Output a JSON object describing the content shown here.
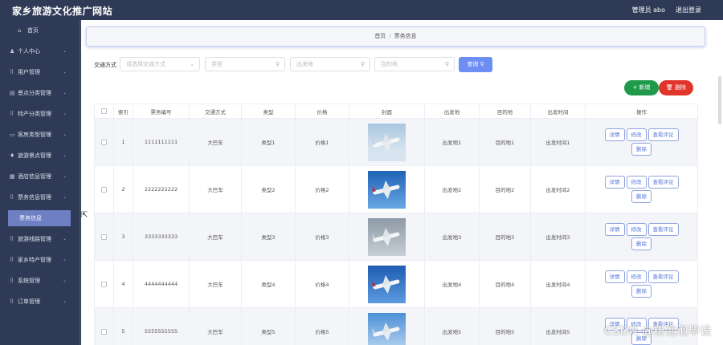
{
  "app": {
    "title": "家乡旅游文化推广网站",
    "user_label": "管理员 abo",
    "logout_label": "退出登录"
  },
  "sidebar": {
    "items": [
      {
        "label": "首页",
        "icon": "home-icon",
        "glyph": "⌂",
        "has_arrow": false
      },
      {
        "label": "个人中心",
        "icon": "user-icon",
        "glyph": "♟",
        "has_arrow": true
      },
      {
        "label": "用户管理",
        "icon": "grid-icon",
        "glyph": "⠿",
        "has_arrow": true
      },
      {
        "label": "景点分类管理",
        "icon": "tag-icon",
        "glyph": "▤",
        "has_arrow": true
      },
      {
        "label": "特产分类管理",
        "icon": "grid-icon",
        "glyph": "⠿",
        "has_arrow": true
      },
      {
        "label": "客房类型管理",
        "icon": "bed-icon",
        "glyph": "▭",
        "has_arrow": true
      },
      {
        "label": "旅游景点管理",
        "icon": "pin-icon",
        "glyph": "♦",
        "has_arrow": true
      },
      {
        "label": "酒店信息管理",
        "icon": "building-icon",
        "glyph": "▦",
        "has_arrow": true
      },
      {
        "label": "票务信息管理",
        "icon": "grid-icon",
        "glyph": "⠿",
        "has_arrow": true
      },
      {
        "label": "票务信息",
        "icon": "",
        "glyph": "",
        "has_arrow": false,
        "active": true
      },
      {
        "label": "旅游线路管理",
        "icon": "grid-icon",
        "glyph": "⠿",
        "has_arrow": true
      },
      {
        "label": "家乡特产管理",
        "icon": "grid-icon",
        "glyph": "⠿",
        "has_arrow": true
      },
      {
        "label": "系统管理",
        "icon": "grid-icon",
        "glyph": "⠿",
        "has_arrow": true
      },
      {
        "label": "订单管理",
        "icon": "grid-icon",
        "glyph": "⠿",
        "has_arrow": true
      }
    ]
  },
  "breadcrumb": {
    "home": "首页",
    "separator": "/",
    "current": "票务信息"
  },
  "filters": {
    "label": "交通方式",
    "transport_placeholder": "请选择交通方式",
    "type_placeholder": "类型",
    "from_placeholder": "出发地",
    "to_placeholder": "目的地",
    "search_label": "查询"
  },
  "actions": {
    "add_label": "新增",
    "delete_label": "删除"
  },
  "table": {
    "columns": [
      "索引",
      "票务编号",
      "交通方式",
      "类型",
      "价格",
      "封面",
      "出发地",
      "目的地",
      "出发时间",
      "操作"
    ],
    "row_buttons": {
      "detail": "详情",
      "edit": "修改",
      "comments": "查看评论",
      "delete": "删除"
    },
    "rows": [
      {
        "index": "1",
        "ticket_no": "1111111111",
        "transport": "大巴车",
        "type": "类型1",
        "price": "价格1",
        "from": "出发地1",
        "to": "目的地1",
        "time": "出发时间1"
      },
      {
        "index": "2",
        "ticket_no": "2222222222",
        "transport": "大巴车",
        "type": "类型2",
        "price": "价格2",
        "from": "出发地2",
        "to": "目的地2",
        "time": "出发时间2"
      },
      {
        "index": "3",
        "ticket_no": "3333333333",
        "transport": "大巴车",
        "type": "类型3",
        "price": "价格3",
        "from": "出发地3",
        "to": "目的地3",
        "time": "出发时间3"
      },
      {
        "index": "4",
        "ticket_no": "4444444444",
        "transport": "大巴车",
        "type": "类型4",
        "price": "价格4",
        "from": "出发地4",
        "to": "目的地4",
        "time": "出发时间4"
      },
      {
        "index": "5",
        "ticket_no": "5555555555",
        "transport": "大巴车",
        "type": "类型5",
        "price": "价格5",
        "from": "出发地5",
        "to": "目的地5",
        "time": "出发时间5"
      }
    ]
  },
  "watermark": "CSDN @粉泡泡毕设",
  "colors": {
    "sidebar": "#2f3a56",
    "active": "#6e7fc3",
    "primary": "#6d8ef3",
    "success": "#1f9a4a",
    "danger": "#e0352b"
  }
}
